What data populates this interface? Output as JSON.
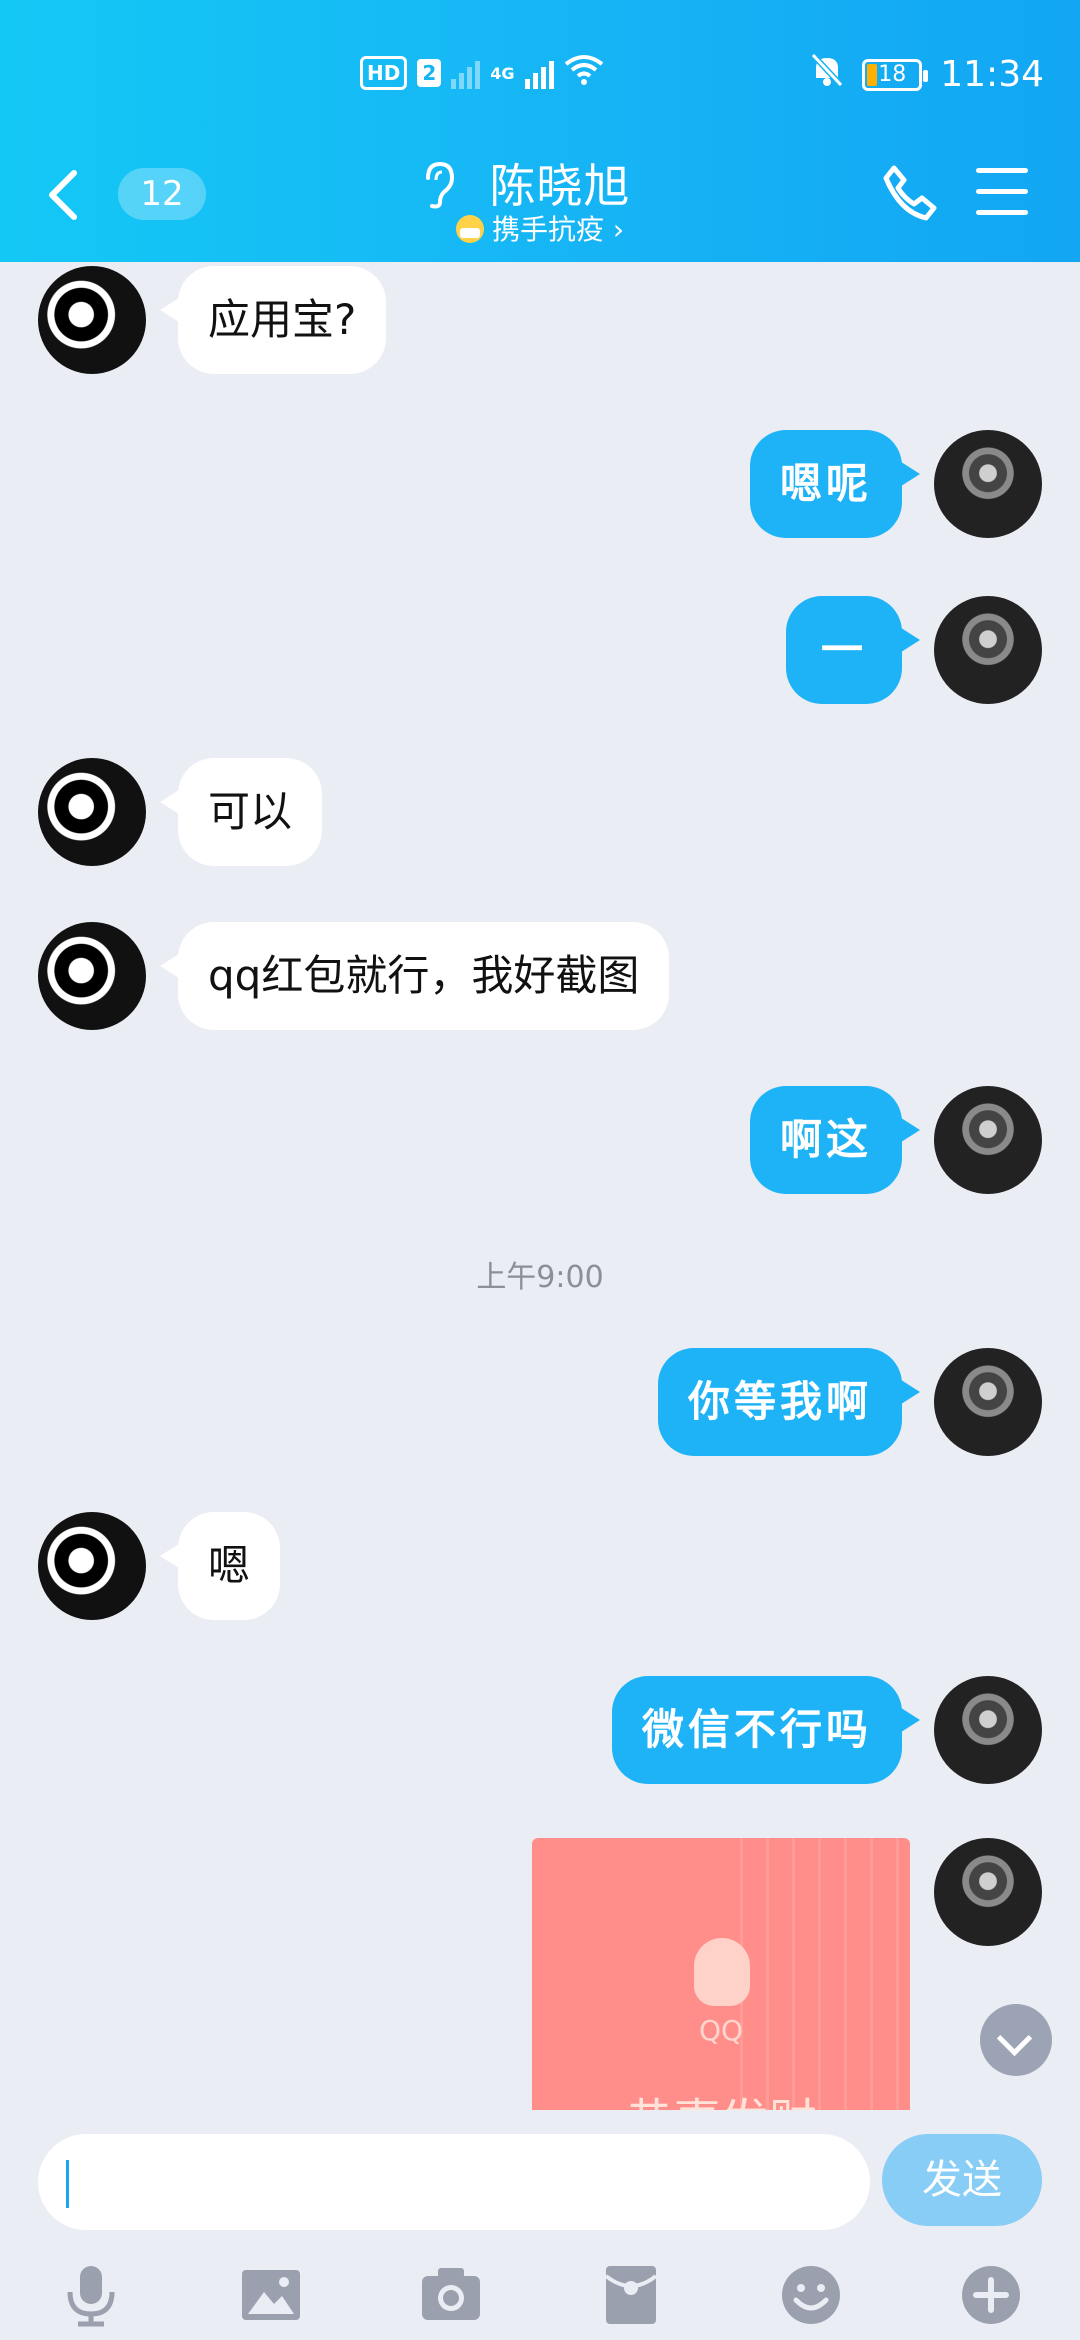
{
  "status_bar": {
    "hd_label": "HD",
    "sim_label": "2",
    "network_label": "4G",
    "battery": "18",
    "time": "11:34"
  },
  "header": {
    "unread_count": "12",
    "title": "陈晓旭",
    "subtitle": "携手抗疫 ›",
    "colors": {
      "gradient_start": "#14c8f5",
      "gradient_end": "#12a6f3"
    }
  },
  "messages": [
    {
      "side": "left",
      "text": "应用宝?"
    },
    {
      "side": "right",
      "text": "嗯呢"
    },
    {
      "side": "right",
      "text": "一"
    },
    {
      "side": "left",
      "text": "可以"
    },
    {
      "side": "left",
      "text": "qq红包就行，我好截图"
    },
    {
      "side": "right",
      "text": "啊这"
    },
    {
      "side": "time",
      "text": "上午9:00"
    },
    {
      "side": "right",
      "text": "你等我啊"
    },
    {
      "side": "left",
      "text": "嗯"
    },
    {
      "side": "right",
      "text": "微信不行吗"
    },
    {
      "side": "right",
      "type": "red_packet",
      "brand": "QQ",
      "text": "恭喜发财"
    }
  ],
  "input": {
    "value": "",
    "placeholder": "",
    "send_label": "发送"
  },
  "toolbar": [
    "mic-icon",
    "image-icon",
    "camera-icon",
    "red-packet-icon",
    "emoji-icon",
    "plus-icon"
  ],
  "colors": {
    "my_bubble": "#1eb3f6",
    "friend_bubble": "#ffffff",
    "chat_bg": "#eaedf4",
    "red_packet": "#ff8e8a"
  }
}
